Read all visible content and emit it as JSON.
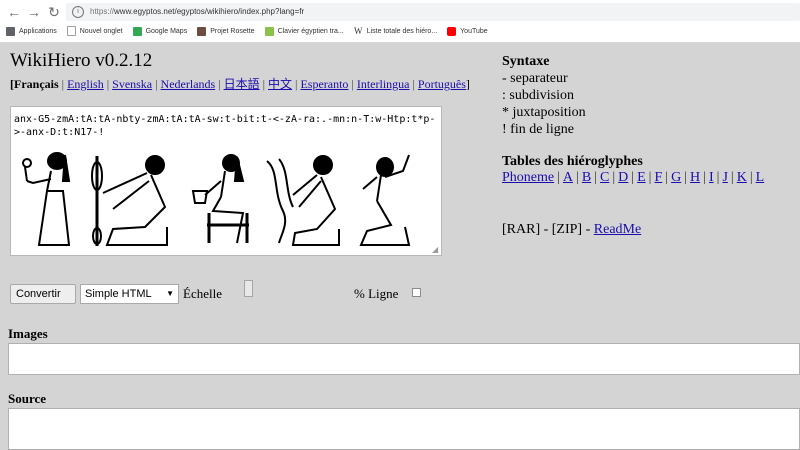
{
  "browser": {
    "url_scheme": "https://",
    "url_rest": "www.egyptos.net/egyptos/wikihiero/index.php?lang=fr",
    "bookmarks": [
      {
        "label": "Applications",
        "icon": "apps-grid-icon",
        "color": "#5f6368"
      },
      {
        "label": "Nouvel onglet",
        "icon": "page-icon",
        "color": "#9aa0a6"
      },
      {
        "label": "Google Maps",
        "icon": "maps-icon",
        "color": "#34a853"
      },
      {
        "label": "Projet Rosette",
        "icon": "rosette-icon",
        "color": "#6d4c41"
      },
      {
        "label": "Clavier égyptien tra...",
        "icon": "keyboard-icon",
        "color": "#8bc34a"
      },
      {
        "label": "Liste totale des hiéro...",
        "icon": "wikipedia-icon",
        "color": "#333333"
      },
      {
        "label": "YouTube",
        "icon": "youtube-icon",
        "color": "#ff0000"
      }
    ]
  },
  "app": {
    "title": "WikiHiero v0.2.12",
    "languages": {
      "current": "[Français",
      "links": [
        "English",
        "Svenska",
        "Nederlands",
        "日本語",
        "中文",
        "Esperanto",
        "Interlingua",
        "Português"
      ],
      "close": "]"
    },
    "input_text": "anx-G5-zmA:tA:tA-nbty-zmA:tA:tA-sw:t-bit:t-<-zA-ra:.-mn:n-T:w-Htp:t*p->-anx-D:t:N17-!",
    "controls": {
      "convert": "Convertir",
      "format": "Simple HTML",
      "scale_label": "Échelle",
      "line_label": "% Ligne"
    },
    "syntax": {
      "title": "Syntaxe",
      "items": [
        "- separateur",
        ": subdivision",
        "* juxtaposition",
        "! fin de ligne"
      ]
    },
    "tables": {
      "title": "Tables des hiéroglyphes",
      "links": [
        "Phoneme",
        "A",
        "B",
        "C",
        "D",
        "E",
        "F",
        "G",
        "H",
        "I",
        "J",
        "K",
        "L"
      ]
    },
    "downloads": {
      "rar": "[RAR] - [ZIP] -",
      "readme": "ReadMe"
    },
    "sections": {
      "images": "Images",
      "source": "Source"
    }
  }
}
